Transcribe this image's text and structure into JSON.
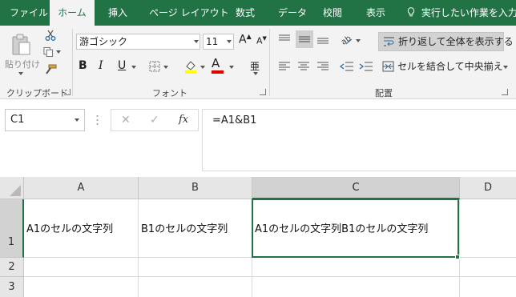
{
  "tabs": [
    "ファイル",
    "ホーム",
    "挿入",
    "ページ レイアウト",
    "数式",
    "データ",
    "校閲",
    "表示"
  ],
  "tell_me": "実行したい作業を入力し",
  "clipboard": {
    "paste_label": "貼り付け",
    "group_label": "クリップボード"
  },
  "font": {
    "name": "游ゴシック",
    "size": "11",
    "group_label": "フォント",
    "bold": "B",
    "italic": "I",
    "underline": "U",
    "grow": "A",
    "shrink": "A",
    "font_color_glyph": "A",
    "phonetic": "亜"
  },
  "alignment": {
    "wrap_label": "折り返して全体を表示する",
    "merge_label": "セルを結合して中央揃え",
    "group_label": "配置"
  },
  "formula_bar": {
    "name_box": "C1",
    "cancel": "✕",
    "enter": "✓",
    "fx": "fx",
    "formula": "=A1&B1"
  },
  "columns": [
    "A",
    "B",
    "C",
    "D"
  ],
  "rows": [
    "1",
    "2",
    "3"
  ],
  "cells": {
    "A1": "A1のセルの文字列",
    "B1": "B1のセルの文字列",
    "C1": "A1のセルの文字列B1のセルの文字列",
    "D1": ""
  },
  "colors": {
    "accent": "#217346",
    "font_color": "#e00000",
    "fill_color": "#ffff00"
  }
}
